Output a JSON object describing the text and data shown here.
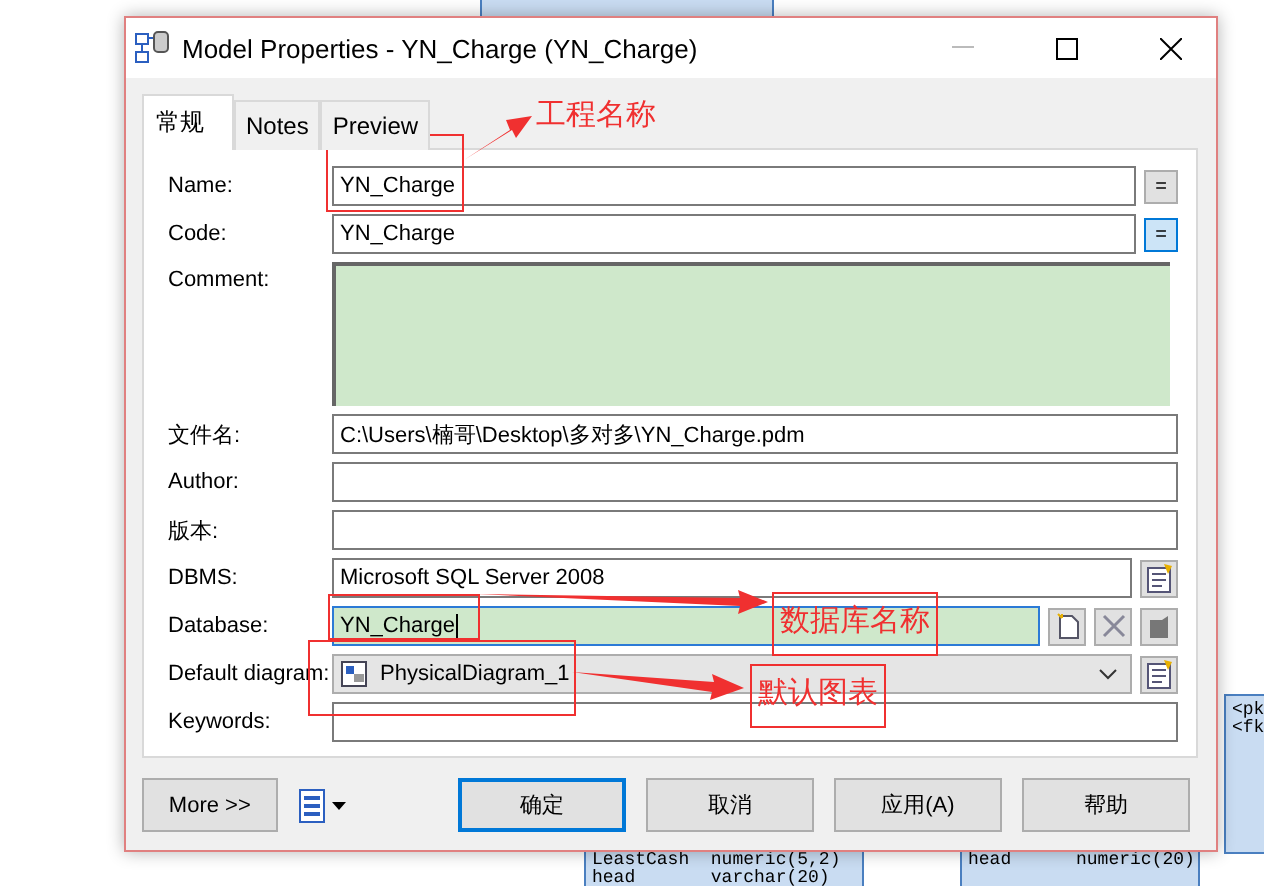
{
  "window": {
    "title": "Model Properties - YN_Charge (YN_Charge)"
  },
  "tabs": [
    {
      "label": "常规",
      "selected": true
    },
    {
      "label": "Notes",
      "selected": false
    },
    {
      "label": "Preview",
      "selected": false
    }
  ],
  "fields": [
    {
      "kind": "text",
      "label": "Name:",
      "value": "YN_Charge",
      "equals": {
        "label": "=",
        "on": false
      }
    },
    {
      "kind": "text",
      "label": "Code:",
      "value": "YN_Charge",
      "equals": {
        "label": "=",
        "on": true
      }
    },
    {
      "kind": "memo",
      "label": "Comment:"
    },
    {
      "kind": "wide",
      "label": "文件名:",
      "value": "C:\\Users\\楠哥\\Desktop\\多对多\\YN_Charge.pdm"
    },
    {
      "kind": "wide",
      "label": "Author:"
    },
    {
      "kind": "wide",
      "label": "版本:"
    },
    {
      "kind": "picker",
      "label": "DBMS:",
      "value": "Microsoft SQL Server 2008"
    },
    {
      "kind": "database",
      "label": "Database:",
      "value": "YN_Charge"
    },
    {
      "kind": "dropdown",
      "label": "Default diagram:",
      "value": "PhysicalDiagram_1"
    },
    {
      "kind": "wide",
      "label": "Keywords:"
    }
  ],
  "buttons": [
    {
      "kind": "more",
      "label": "More >>"
    },
    {
      "kind": "menu"
    },
    {
      "kind": "default",
      "label": "确定"
    },
    {
      "kind": "plain",
      "label": "取消"
    },
    {
      "kind": "plain",
      "label": "应用(A)"
    },
    {
      "kind": "plain",
      "label": "帮助"
    }
  ],
  "annotations": [
    {
      "kind": "plain",
      "text": "工程名称"
    },
    {
      "kind": "boxed",
      "text": "数据库名称"
    },
    {
      "kind": "boxed",
      "text": "默认图表"
    }
  ],
  "background_tables": [
    {
      "rows": [
        "<pk",
        "<fk"
      ]
    },
    {
      "rows": [
        "LeastCash  numeric(5,2)",
        "head       varchar(20)"
      ]
    },
    {
      "rows": [
        "head      numeric(20)"
      ]
    }
  ]
}
